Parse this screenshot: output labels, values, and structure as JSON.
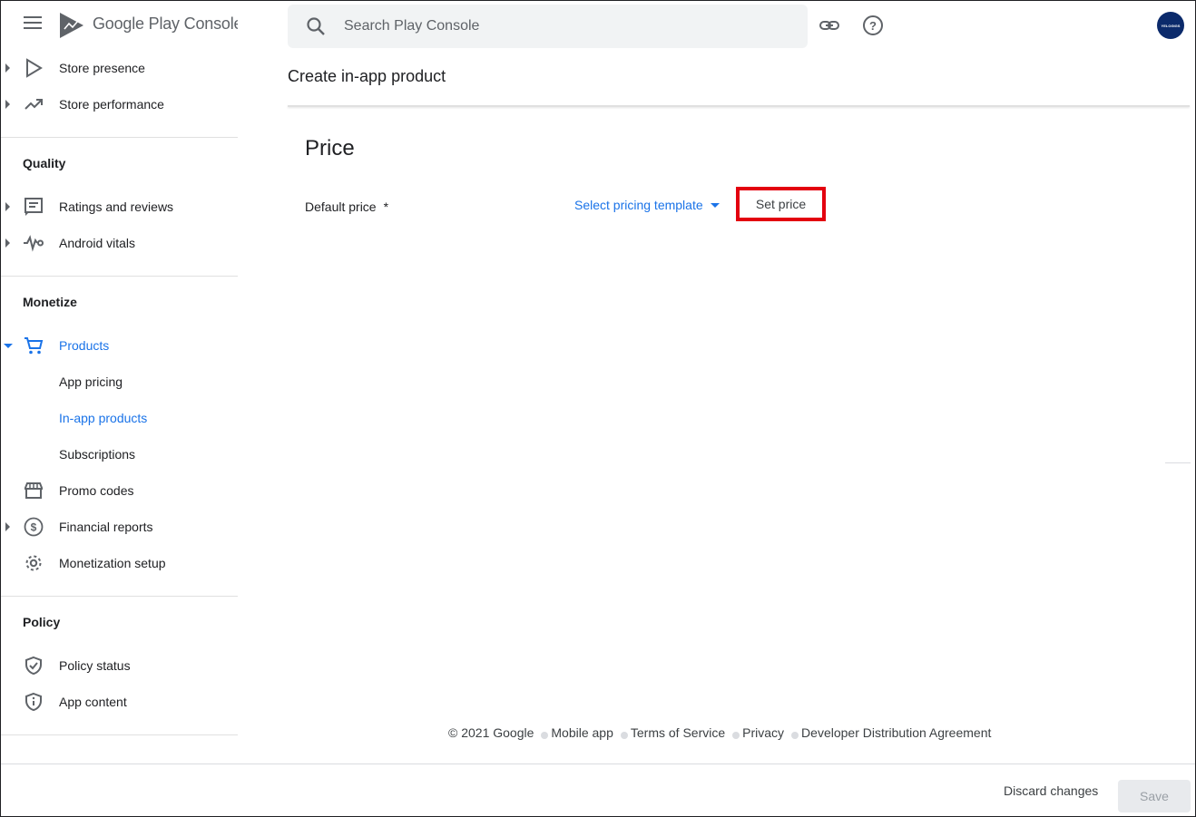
{
  "header": {
    "brand": "Google Play Console",
    "search_placeholder": "Search Play Console",
    "avatar_text": "YELOGIGS"
  },
  "sidebar": {
    "top_items": [
      {
        "label": "Store presence",
        "icon": "play-outline-icon"
      },
      {
        "label": "Store performance",
        "icon": "trending-up-icon"
      }
    ],
    "sections": {
      "quality": {
        "title": "Quality",
        "items": [
          {
            "label": "Ratings and reviews",
            "icon": "review-icon"
          },
          {
            "label": "Android vitals",
            "icon": "vitals-icon"
          }
        ]
      },
      "monetize": {
        "title": "Monetize",
        "items": [
          {
            "label": "Products",
            "icon": "cart-icon"
          },
          {
            "label": "App pricing"
          },
          {
            "label": "In-app products"
          },
          {
            "label": "Subscriptions"
          },
          {
            "label": "Promo codes",
            "icon": "store-icon"
          },
          {
            "label": "Financial reports",
            "icon": "dollar-icon"
          },
          {
            "label": "Monetization setup",
            "icon": "gear-icon"
          }
        ]
      },
      "policy": {
        "title": "Policy",
        "items": [
          {
            "label": "Policy status",
            "icon": "shield-check-icon"
          },
          {
            "label": "App content",
            "icon": "shield-info-icon"
          }
        ]
      }
    }
  },
  "main": {
    "page_title": "Create in-app product",
    "section_title": "Price",
    "default_price_label": "Default price",
    "required_marker": "*",
    "pricing_template_label": "Select pricing template",
    "set_price_label": "Set price"
  },
  "footer": {
    "copyright": "© 2021 Google",
    "links": [
      "Mobile app",
      "Terms of Service",
      "Privacy",
      "Developer Distribution Agreement"
    ]
  },
  "actions": {
    "discard_label": "Discard changes",
    "save_label": "Save"
  },
  "colors": {
    "accent": "#1a73e8",
    "highlight_border": "#e3000f",
    "avatar_bg": "#0b2a6b"
  }
}
